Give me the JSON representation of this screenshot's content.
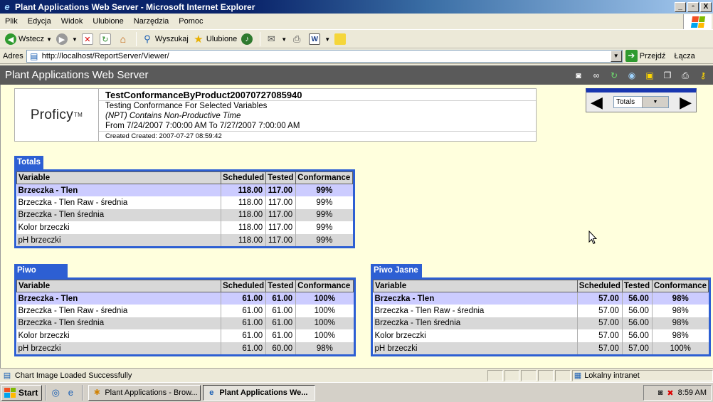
{
  "window": {
    "title": "Plant Applications Web Server - Microsoft Internet Explorer",
    "buttons": [
      "_",
      "▫",
      "X"
    ]
  },
  "menu": [
    "Plik",
    "Edycja",
    "Widok",
    "Ulubione",
    "Narzędzia",
    "Pomoc"
  ],
  "toolbar": {
    "back_label": "Wstecz",
    "search_label": "Wyszukaj",
    "favorites_label": "Ulubione"
  },
  "address": {
    "label": "Adres",
    "url": "http://localhost/ReportServer/Viewer/",
    "go_label": "Przejdź",
    "links_label": "Łącza"
  },
  "viewer": {
    "title": "Plant Applications Web Server"
  },
  "report": {
    "logo_text": "Proficy",
    "logo_tm": "TM",
    "title": "TestConformanceByProduct20070727085940",
    "subtitle": "Testing Conformance For Selected Variables",
    "npt_prefix": "(NPT)",
    "npt_text": " Contains Non-Productive Time",
    "range": "From 7/24/2007 7:00:00 AM To 7/27/2007 7:00:00 AM",
    "created": "Created Created: 2007-07-27 08:59:42"
  },
  "nav": {
    "selected": "Totals"
  },
  "columns": [
    "Variable",
    "Scheduled",
    "Tested",
    "Conformance"
  ],
  "sections": {
    "totals": {
      "title": "Totals",
      "rows": [
        [
          "Brzeczka - Tlen",
          "118.00",
          "117.00",
          "99%"
        ],
        [
          "Brzeczka - Tlen Raw - średnia",
          "118.00",
          "117.00",
          "99%"
        ],
        [
          "Brzeczka - Tlen średnia",
          "118.00",
          "117.00",
          "99%"
        ],
        [
          "Kolor brzeczki",
          "118.00",
          "117.00",
          "99%"
        ],
        [
          "pH brzeczki",
          "118.00",
          "117.00",
          "99%"
        ]
      ]
    },
    "piwo": {
      "title": "Piwo",
      "rows": [
        [
          "Brzeczka - Tlen",
          "61.00",
          "61.00",
          "100%"
        ],
        [
          "Brzeczka - Tlen Raw - średnia",
          "61.00",
          "61.00",
          "100%"
        ],
        [
          "Brzeczka - Tlen średnia",
          "61.00",
          "61.00",
          "100%"
        ],
        [
          "Kolor brzeczki",
          "61.00",
          "61.00",
          "100%"
        ],
        [
          "pH brzeczki",
          "61.00",
          "60.00",
          "98%"
        ]
      ]
    },
    "piwo_jasne": {
      "title": "Piwo Jasne",
      "rows": [
        [
          "Brzeczka - Tlen",
          "57.00",
          "56.00",
          "98%"
        ],
        [
          "Brzeczka - Tlen Raw - średnia",
          "57.00",
          "56.00",
          "98%"
        ],
        [
          "Brzeczka - Tlen średnia",
          "57.00",
          "56.00",
          "98%"
        ],
        [
          "Kolor brzeczki",
          "57.00",
          "56.00",
          "98%"
        ],
        [
          "pH brzeczki",
          "57.00",
          "57.00",
          "100%"
        ]
      ]
    }
  },
  "status": {
    "text": "Chart Image Loaded Successfully",
    "zone": "Lokalny intranet"
  },
  "taskbar": {
    "start_label": "Start",
    "tasks": [
      "Plant Applications - Brow...",
      "Plant Applications We..."
    ],
    "clock": "8:59 AM"
  }
}
